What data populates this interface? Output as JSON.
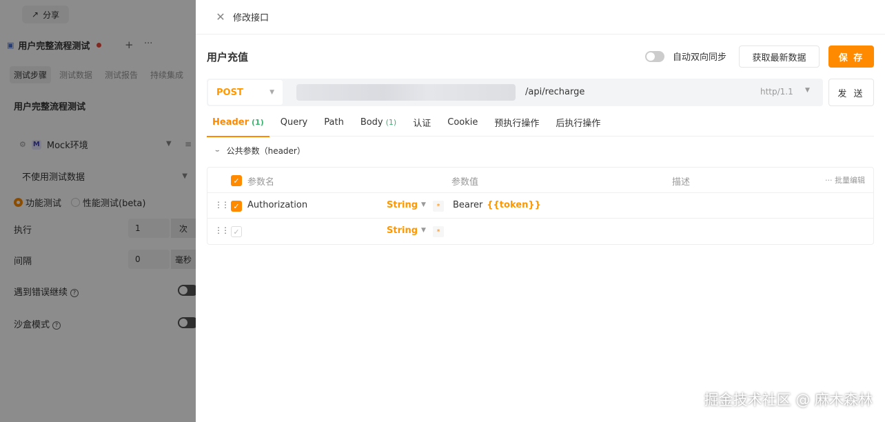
{
  "left": {
    "share_label": "分享",
    "tab_title": "用户完整流程测试",
    "subtabs": [
      "测试步骤",
      "测试数据",
      "测试报告",
      "持续集成"
    ],
    "flow_title": "用户完整流程测试",
    "env_badge": "M",
    "env_label": "Mock环境",
    "data_select": "不使用测试数据",
    "mode_functional": "功能测试",
    "mode_performance": "性能测试(beta)",
    "exec_label": "执行",
    "exec_value": "1",
    "exec_unit": "次",
    "interval_label": "间隔",
    "interval_value": "0",
    "interval_unit": "毫秒",
    "continue_on_error": "遇到错误继续",
    "sandbox_mode": "沙盒模式"
  },
  "drawer": {
    "title": "修改接口",
    "api_name": "用户充值",
    "sync_label": "自动双向同步",
    "fetch_button": "获取最新数据",
    "save_button": "保 存",
    "method": "POST",
    "path": "/api/recharge",
    "protocol": "http/1.1",
    "send_button": "发 送",
    "tabs": [
      {
        "label": "Header",
        "count": "(1)"
      },
      {
        "label": "Query",
        "count": ""
      },
      {
        "label": "Path",
        "count": ""
      },
      {
        "label": "Body",
        "count": "(1)"
      },
      {
        "label": "认证",
        "count": ""
      },
      {
        "label": "Cookie",
        "count": ""
      },
      {
        "label": "预执行操作",
        "count": ""
      },
      {
        "label": "后执行操作",
        "count": ""
      }
    ],
    "public_params": "公共参数（header）",
    "table": {
      "headers": {
        "name": "参数名",
        "value": "参数值",
        "desc": "描述",
        "bulk": "批量编辑"
      },
      "rows": [
        {
          "name": "Authorization",
          "type": "String",
          "value_prefix": "Bearer",
          "value_var": "{{token}}"
        },
        {
          "name": "",
          "type": "String",
          "value_prefix": "",
          "value_var": ""
        }
      ]
    }
  },
  "watermark": "掘金技术社区 @ 麻木森林",
  "colors": {
    "accent": "#ff8a00",
    "count_green": "#3cb371"
  }
}
